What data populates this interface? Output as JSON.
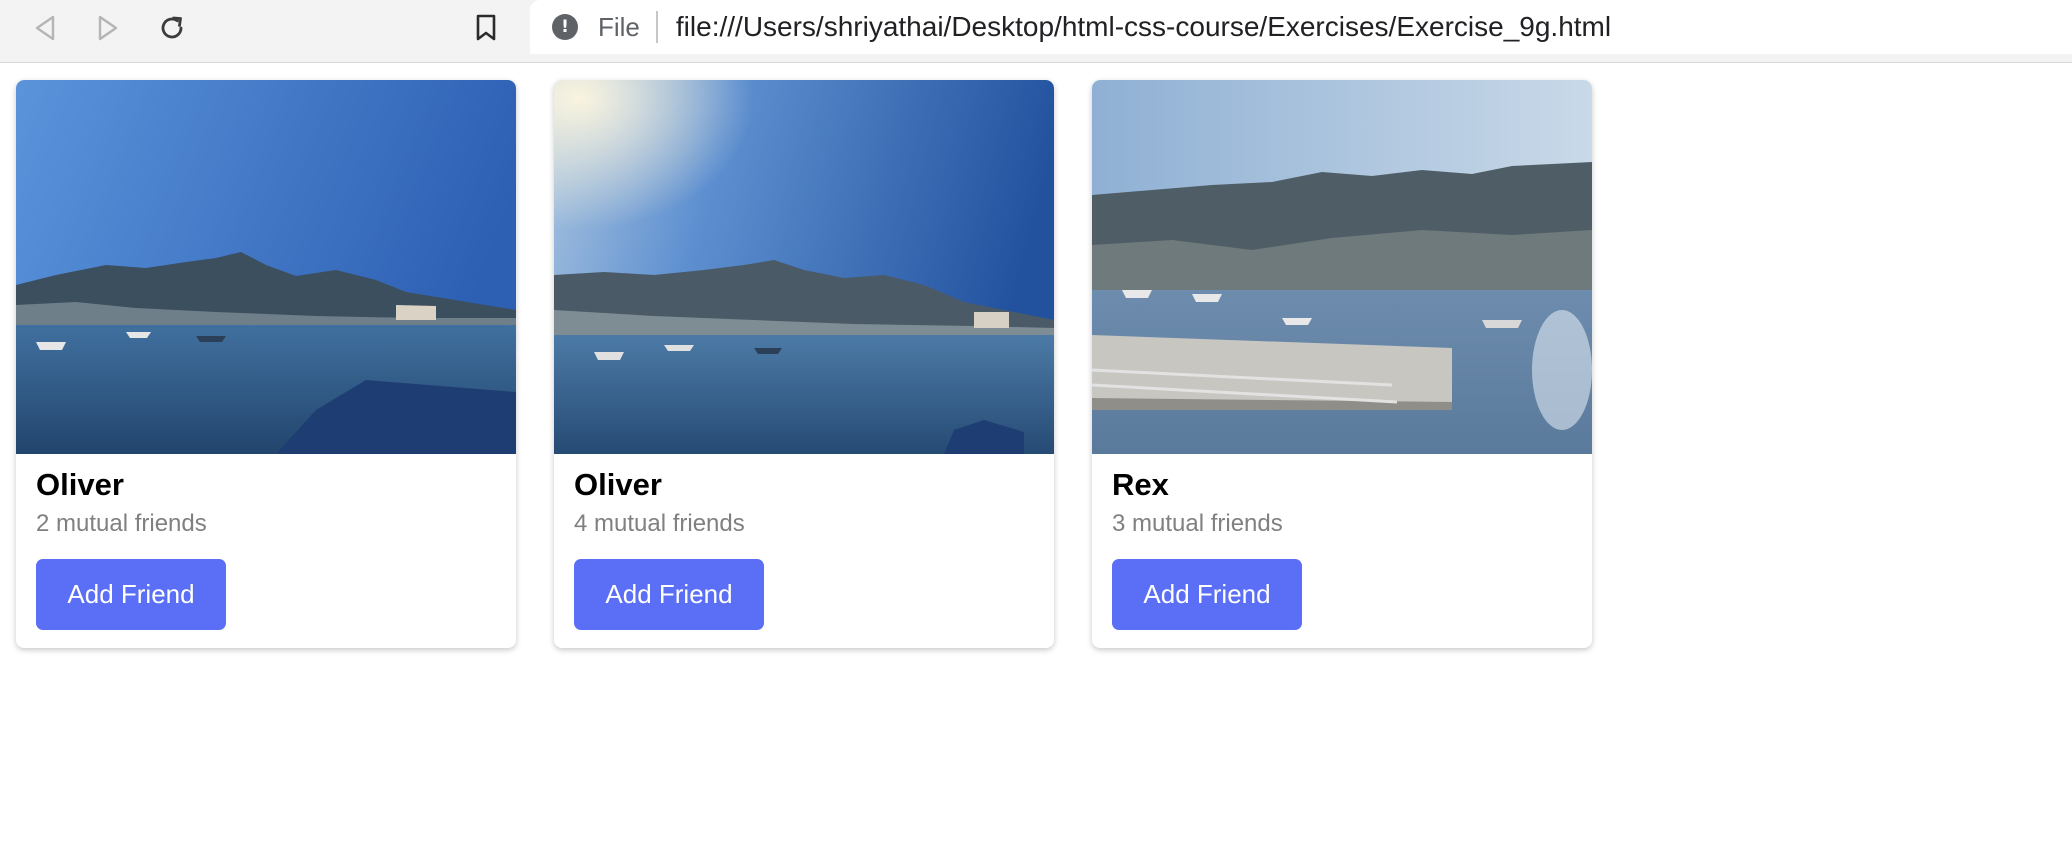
{
  "browser": {
    "scheme_label": "File",
    "url": "file:///Users/shriyathai/Desktop/html-css-course/Exercises/Exercise_9g.html",
    "icons": {
      "back": "back-arrow-icon",
      "forward": "forward-arrow-icon",
      "reload": "reload-icon",
      "bookmark": "bookmark-icon",
      "info": "info-icon"
    }
  },
  "colors": {
    "button_bg": "#5a6ff5",
    "button_text": "#ffffff",
    "mutual_text": "#808080"
  },
  "cards": [
    {
      "name": "Oliver",
      "mutual": "2 mutual friends",
      "button": "Add Friend",
      "photo": "harbor-photo-1"
    },
    {
      "name": "Oliver",
      "mutual": "4 mutual friends",
      "button": "Add Friend",
      "photo": "harbor-photo-2"
    },
    {
      "name": "Rex",
      "mutual": "3 mutual friends",
      "button": "Add Friend",
      "photo": "harbor-dock-photo"
    }
  ]
}
